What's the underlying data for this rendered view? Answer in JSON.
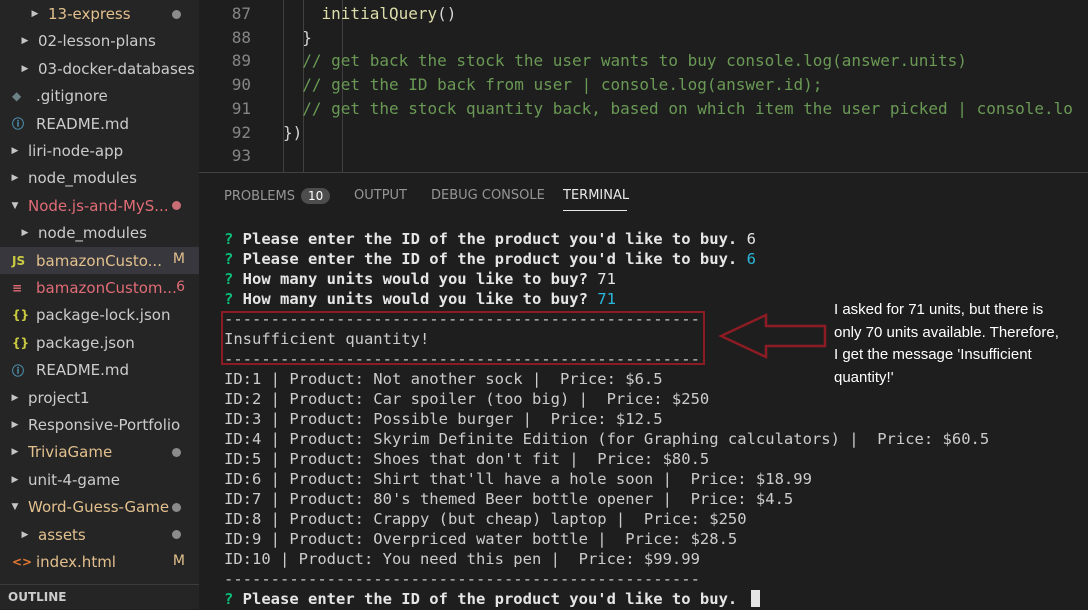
{
  "explorer": {
    "items": [
      {
        "label": "13-express",
        "color": "#e2c08d",
        "chev": "▶",
        "indent": 1,
        "decoration": "dot"
      },
      {
        "label": "02-lesson-plans",
        "color": "#cccccc",
        "chev": "▶",
        "indent": 0,
        "decoration": ""
      },
      {
        "label": "03-docker-databases",
        "color": "#cccccc",
        "chev": "▶",
        "indent": 0,
        "decoration": ""
      },
      {
        "label": ".gitignore",
        "color": "#cccccc",
        "chev": "",
        "indent": 0,
        "icon": "◆",
        "icon_color": "#6d8086",
        "icon_name": "git-icon",
        "decoration": ""
      },
      {
        "label": "README.md",
        "color": "#cccccc",
        "chev": "",
        "indent": 0,
        "icon": "ⓘ",
        "icon_color": "#519aba",
        "icon_name": "info-icon",
        "decoration": ""
      },
      {
        "label": "liri-node-app",
        "color": "#cccccc",
        "chev": "▶",
        "indent": -1,
        "decoration": ""
      },
      {
        "label": "node_modules",
        "color": "#cccccc",
        "chev": "▶",
        "indent": -1,
        "decoration": ""
      },
      {
        "label": "Node.js-and-MyS...",
        "color": "#e06c75",
        "chev": "▼",
        "indent": -1,
        "decoration": "dot",
        "dot_color": "#c86d74"
      },
      {
        "label": "node_modules",
        "color": "#cccccc",
        "chev": "▶",
        "indent": 0,
        "decoration": ""
      },
      {
        "label": "bamazonCusto...",
        "color": "#e2c08d",
        "chev": "",
        "indent": 0,
        "icon": "JS",
        "icon_color": "#cbcb41",
        "icon_name": "javascript-file-icon",
        "decoration": "badge",
        "badge": "M",
        "badge_color": "#e2c08d",
        "selected": true
      },
      {
        "label": "bamazonCustom...",
        "color": "#e06c75",
        "chev": "",
        "indent": 0,
        "icon": "≡",
        "icon_color": "#e06c75",
        "icon_name": "database-icon",
        "decoration": "badge",
        "badge": "6",
        "badge_color": "#e06c75"
      },
      {
        "label": "package-lock.json",
        "color": "#cccccc",
        "chev": "",
        "indent": 0,
        "icon": "{}",
        "icon_color": "#cbcb41",
        "icon_name": "json-icon",
        "decoration": ""
      },
      {
        "label": "package.json",
        "color": "#cccccc",
        "chev": "",
        "indent": 0,
        "icon": "{}",
        "icon_color": "#cbcb41",
        "icon_name": "json-icon",
        "decoration": ""
      },
      {
        "label": "README.md",
        "color": "#cccccc",
        "chev": "",
        "indent": 0,
        "icon": "ⓘ",
        "icon_color": "#519aba",
        "icon_name": "info-icon",
        "decoration": ""
      },
      {
        "label": "project1",
        "color": "#cccccc",
        "chev": "▶",
        "indent": -1,
        "decoration": ""
      },
      {
        "label": "Responsive-Portfolio",
        "color": "#cccccc",
        "chev": "▶",
        "indent": -1,
        "decoration": ""
      },
      {
        "label": "TriviaGame",
        "color": "#e2c08d",
        "chev": "▶",
        "indent": -1,
        "decoration": "dot"
      },
      {
        "label": "unit-4-game",
        "color": "#cccccc",
        "chev": "▶",
        "indent": -1,
        "decoration": ""
      },
      {
        "label": "Word-Guess-Game",
        "color": "#e2c08d",
        "chev": "▼",
        "indent": -1,
        "decoration": "dot"
      },
      {
        "label": "assets",
        "color": "#e2c08d",
        "chev": "▶",
        "indent": 0,
        "decoration": "dot"
      },
      {
        "label": "index.html",
        "color": "#e2c08d",
        "chev": "",
        "indent": 0,
        "icon": "<>",
        "icon_color": "#e37933",
        "icon_name": "html-file-icon",
        "decoration": "badge",
        "badge": "M",
        "badge_color": "#e2c08d"
      }
    ],
    "outline_label": "OUTLINE"
  },
  "editor": {
    "lines": [
      {
        "num": "87",
        "text": "    initialQuery()",
        "cls": "fn"
      },
      {
        "num": "88",
        "text": "  }",
        "cls": ""
      },
      {
        "num": "89",
        "text": "  // get back the stock the user wants to buy console.log(answer.units)",
        "cls": "comment"
      },
      {
        "num": "90",
        "text": "  // get the ID back from user | console.log(answer.id);",
        "cls": "comment"
      },
      {
        "num": "91",
        "text": "  // get the stock quantity back, based on which item the user picked | console.lo",
        "cls": "comment"
      },
      {
        "num": "92",
        "text": "})",
        "cls": ""
      },
      {
        "num": "93",
        "text": "",
        "cls": ""
      }
    ]
  },
  "panel": {
    "tabs": {
      "problems": "PROBLEMS",
      "problems_count": "10",
      "output": "OUTPUT",
      "debug": "DEBUG CONSOLE",
      "terminal": "TERMINAL"
    }
  },
  "terminal": {
    "prompt_mark": "?",
    "prompts": [
      {
        "question": "Please enter the ID of the product you'd like to buy.",
        "answer": "6",
        "answer_style": "plain"
      },
      {
        "question": "Please enter the ID of the product you'd like to buy.",
        "answer": "6",
        "answer_style": "cyan"
      },
      {
        "question": "How many units would you like to buy?",
        "answer": "71",
        "answer_style": "plain"
      },
      {
        "question": "How many units would you like to buy?",
        "answer": "71",
        "answer_style": "cyan"
      }
    ],
    "separator": "---------------------------------------------------",
    "insufficient": "Insufficient quantity!",
    "products": [
      "ID:1 | Product: Not another sock |  Price: $6.5",
      "ID:2 | Product: Car spoiler (too big) |  Price: $250",
      "ID:3 | Product: Possible burger |  Price: $12.5",
      "ID:4 | Product: Skyrim Definite Edition (for Graphing calculators) |  Price: $60.5",
      "ID:5 | Product: Shoes that don't fit |  Price: $80.5",
      "ID:6 | Product: Shirt that'll have a hole soon |  Price: $18.99",
      "ID:7 | Product: 80's themed Beer bottle opener |  Price: $4.5",
      "ID:8 | Product: Crappy (but cheap) laptop |  Price: $250",
      "ID:9 | Product: Overpriced water bottle |  Price: $28.5",
      "ID:10 | Product: You need this pen |  Price: $99.99"
    ],
    "final_prompt": "Please enter the ID of the product you'd like to buy."
  },
  "annotation": {
    "lines": [
      "I asked for 71 units, but there is",
      "only 70 units available. Therefore,",
      "I get the message 'Insufficient",
      "quantity!'"
    ],
    "arrow_color": "#8b1c24"
  }
}
